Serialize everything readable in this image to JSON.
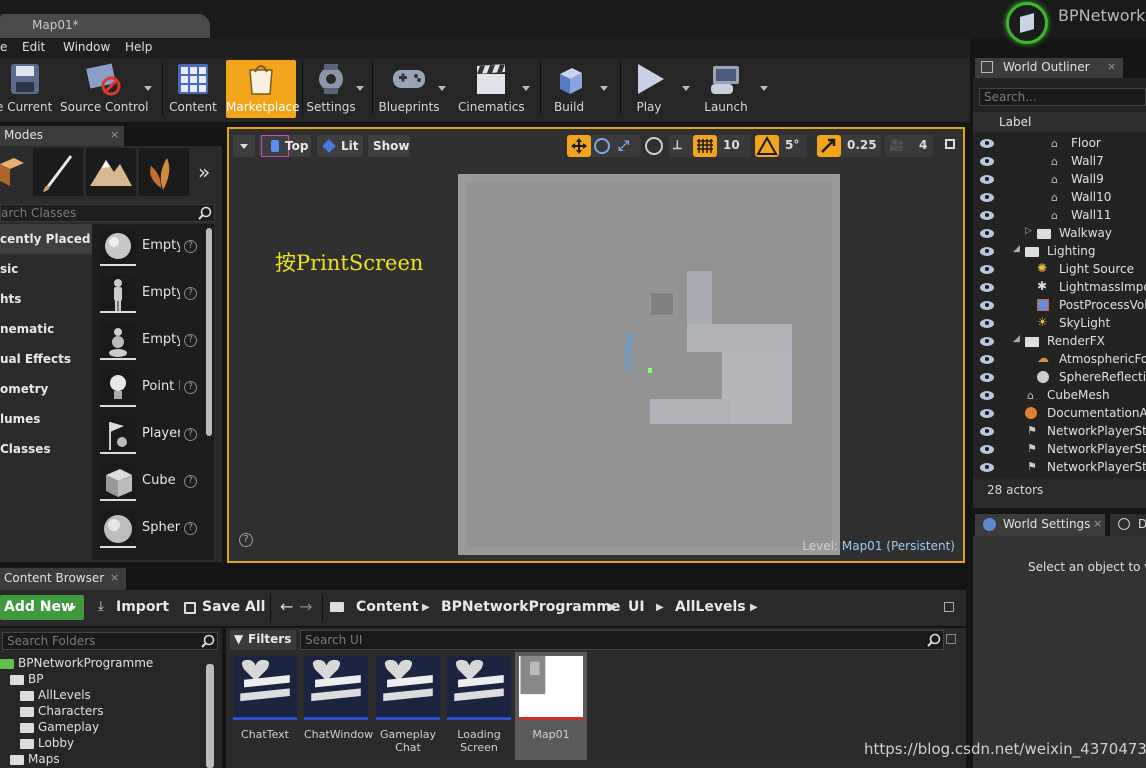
{
  "window": {
    "tab_title": "Map01*",
    "brand": "BPNetwork"
  },
  "menu": [
    "e",
    "Edit",
    "Window",
    "Help"
  ],
  "toolbar": {
    "buttons": [
      {
        "label": "e Current"
      },
      {
        "label": "Source Control"
      },
      {
        "label": "Content"
      },
      {
        "label": "Marketplace"
      },
      {
        "label": "Settings"
      },
      {
        "label": "Blueprints"
      },
      {
        "label": "Cinematics"
      },
      {
        "label": "Build"
      },
      {
        "label": "Play"
      },
      {
        "label": "Launch"
      }
    ]
  },
  "modes": {
    "tab_label": "Modes",
    "search_placeholder": "arch Classes",
    "categories": [
      "cently Placed",
      "sic",
      "hts",
      "nematic",
      "ual Effects",
      "ometry",
      "lumes",
      "Classes"
    ],
    "items": [
      "Empty",
      "Empty",
      "Empty",
      "Point L",
      "Player",
      "Cube",
      "Spher"
    ],
    "help": "?"
  },
  "viewport": {
    "view_label": "Top",
    "lit_label": "Lit",
    "show_label": "Show",
    "grid_snap": "10",
    "rot_snap": "5°",
    "scale_snap": "0.25",
    "cam_speed": "4",
    "overlay_text": "按PrintScreen",
    "map_label": "Map01",
    "level_prefix": "Level:",
    "level_name": "Map01 (Persistent)",
    "help": "?"
  },
  "outliner": {
    "tab_label": "World Outliner",
    "search_placeholder": "Search...",
    "column_label": "Label",
    "rows": [
      {
        "label": "Floor"
      },
      {
        "label": "Wall7"
      },
      {
        "label": "Wall9"
      },
      {
        "label": "Wall10"
      },
      {
        "label": "Wall11"
      },
      {
        "label": "Walkway"
      },
      {
        "label": "Lighting"
      },
      {
        "label": "Light Source"
      },
      {
        "label": "LightmassImpor"
      },
      {
        "label": "PostProcessVol"
      },
      {
        "label": "SkyLight"
      },
      {
        "label": "RenderFX"
      },
      {
        "label": "AtmosphericFog"
      },
      {
        "label": "SphereReflection"
      },
      {
        "label": "CubeMesh"
      },
      {
        "label": "DocumentationAct"
      },
      {
        "label": "NetworkPlayerStar"
      },
      {
        "label": "NetworkPlayerStar"
      },
      {
        "label": "NetworkPlayerStar"
      }
    ],
    "actor_count": "28 actors"
  },
  "world_settings": {
    "tab_label": "World Settings",
    "tab2_label": "D",
    "message": "Select an object to vie"
  },
  "content_browser": {
    "tab_label": "Content Browser",
    "add_new": "Add New",
    "import": "Import",
    "save_all": "Save All",
    "path": [
      "Content",
      "BPNetworkProgramme",
      "UI",
      "AllLevels"
    ],
    "search_folders_placeholder": "Search Folders",
    "filters_label": "Filters",
    "search_ui_placeholder": "Search UI",
    "folders": [
      "BPNetworkProgramme",
      "BP",
      "AllLevels",
      "Characters",
      "Gameplay",
      "Lobby",
      "Maps"
    ],
    "assets": [
      {
        "name": "ChatText"
      },
      {
        "name": "ChatWindow"
      },
      {
        "name": "Gameplay Chat"
      },
      {
        "name": "Loading Screen"
      },
      {
        "name": "Map01"
      }
    ]
  },
  "watermark": "https://blog.csdn.net/weixin_43704737",
  "colors": {
    "accent": "#e0a21b",
    "selected": "#f2a51b",
    "asset_bar": "#2f4fd0",
    "level_name": "#9ccaf0"
  }
}
